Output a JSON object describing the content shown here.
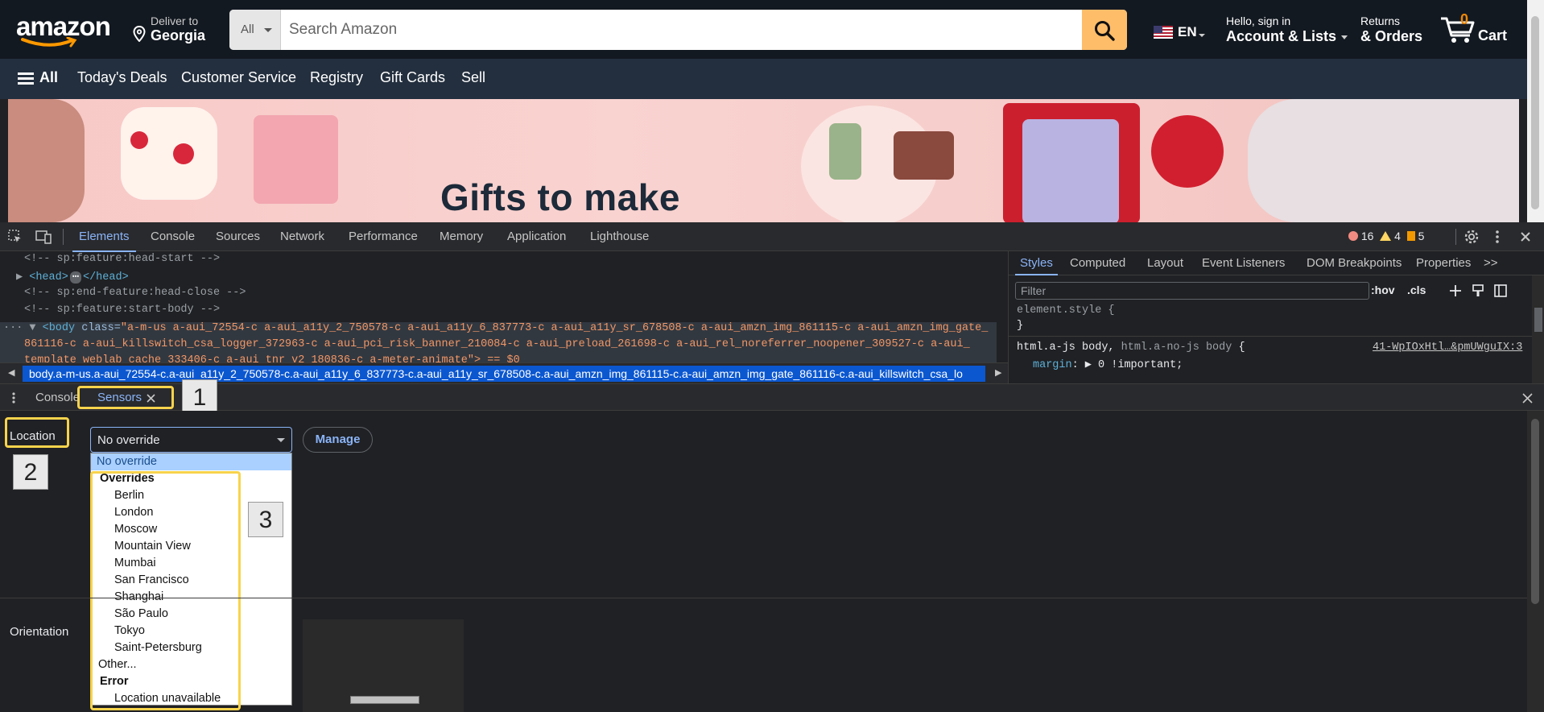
{
  "amazon": {
    "logo": "amazon",
    "deliver": {
      "line1": "Deliver to",
      "line2": "Georgia",
      "icon": "location-pin-icon"
    },
    "search": {
      "category": "All",
      "placeholder": "Search Amazon",
      "icon": "search-icon"
    },
    "language": {
      "code": "EN",
      "flag": "us-flag-icon"
    },
    "account": {
      "line1": "Hello, sign in",
      "line2": "Account & Lists"
    },
    "returns": {
      "line1": "Returns",
      "line2": "& Orders"
    },
    "cart": {
      "count": "0",
      "label": "Cart",
      "icon": "cart-icon"
    },
    "nav": {
      "all": "All",
      "items": [
        "Today's Deals",
        "Customer Service",
        "Registry",
        "Gift Cards",
        "Sell"
      ]
    },
    "hero": {
      "title": "Gifts to make"
    },
    "colors": {
      "header": "#131921",
      "nav": "#232f3e",
      "search_button": "#febd69",
      "cart_count": "#f08804"
    }
  },
  "devtools": {
    "tabs": [
      "Elements",
      "Console",
      "Sources",
      "Network",
      "Performance",
      "Memory",
      "Application",
      "Lighthouse"
    ],
    "active_tab": "Elements",
    "counts": {
      "errors": "16",
      "warnings": "4",
      "issues": "5"
    },
    "dom": {
      "line1": "<!-- sp:feature:head-start -->",
      "line2_tag_open": "<head>",
      "line2_ellipsis": "⋯",
      "line2_tag_close": "</head>",
      "line3": "<!-- sp:end-feature:head-close -->",
      "line4": "<!-- sp:feature:start-body -->",
      "body_open": "<body",
      "body_attr": "class=",
      "body_class_1": "\"a-m-us a-aui_72554-c a-aui_a11y_2_750578-c a-aui_a11y_6_837773-c a-aui_a11y_sr_678508-c a-aui_amzn_img_861115-c a-aui_amzn_img_gate_",
      "body_class_2": "861116-c a-aui_killswitch_csa_logger_372963-c a-aui_pci_risk_banner_210084-c a-aui_preload_261698-c a-aui_rel_noreferrer_noopener_309527-c a-aui_",
      "body_class_3": "template_weblab_cache_333406-c a-aui_tnr_v2_180836-c a-meter-animate\"> == $0"
    },
    "breadcrumb": "body.a-m-us.a-aui_72554-c.a-aui_a11y_2_750578-c.a-aui_a11y_6_837773-c.a-aui_a11y_sr_678508-c.a-aui_amzn_img_861115-c.a-aui_amzn_img_gate_861116-c.a-aui_killswitch_csa_lo",
    "styles": {
      "tabs": [
        "Styles",
        "Computed",
        "Layout",
        "Event Listeners",
        "DOM Breakpoints",
        "Properties"
      ],
      "active_tab": "Styles",
      "filter_placeholder": "Filter",
      "hov": ":hov",
      "cls": ".cls",
      "element_style": "element.style {",
      "close_brace": "}",
      "rule_selector_1": "html.a-js body",
      "rule_sep": ", ",
      "rule_selector_2": "html.a-no-js body",
      "rule_open": " {",
      "rule_source": "41-WpIOxHtl…&pmUWguIX:3",
      "rule_prop": "margin",
      "rule_value": ": ▶ 0 !important;"
    },
    "drawer": {
      "tabs": [
        "Console",
        "Sensors"
      ],
      "active_tab": "Sensors",
      "location_label": "Location",
      "location_value": "No override",
      "manage_label": "Manage",
      "orientation_label": "Orientation",
      "dropdown": {
        "selected": "No override",
        "group_overrides": "Overrides",
        "overrides": [
          "Berlin",
          "London",
          "Moscow",
          "Mountain View",
          "Mumbai",
          "San Francisco",
          "Shanghai",
          "São Paulo",
          "Tokyo",
          "Saint-Petersburg"
        ],
        "other": "Other...",
        "group_error": "Error",
        "errors": [
          "Location unavailable"
        ]
      }
    },
    "annotations": [
      "1",
      "2",
      "3"
    ],
    "colors": {
      "accent": "#8ab4f8",
      "highlight": "#f8d34c",
      "selected_option": "#a9d0ff"
    }
  }
}
